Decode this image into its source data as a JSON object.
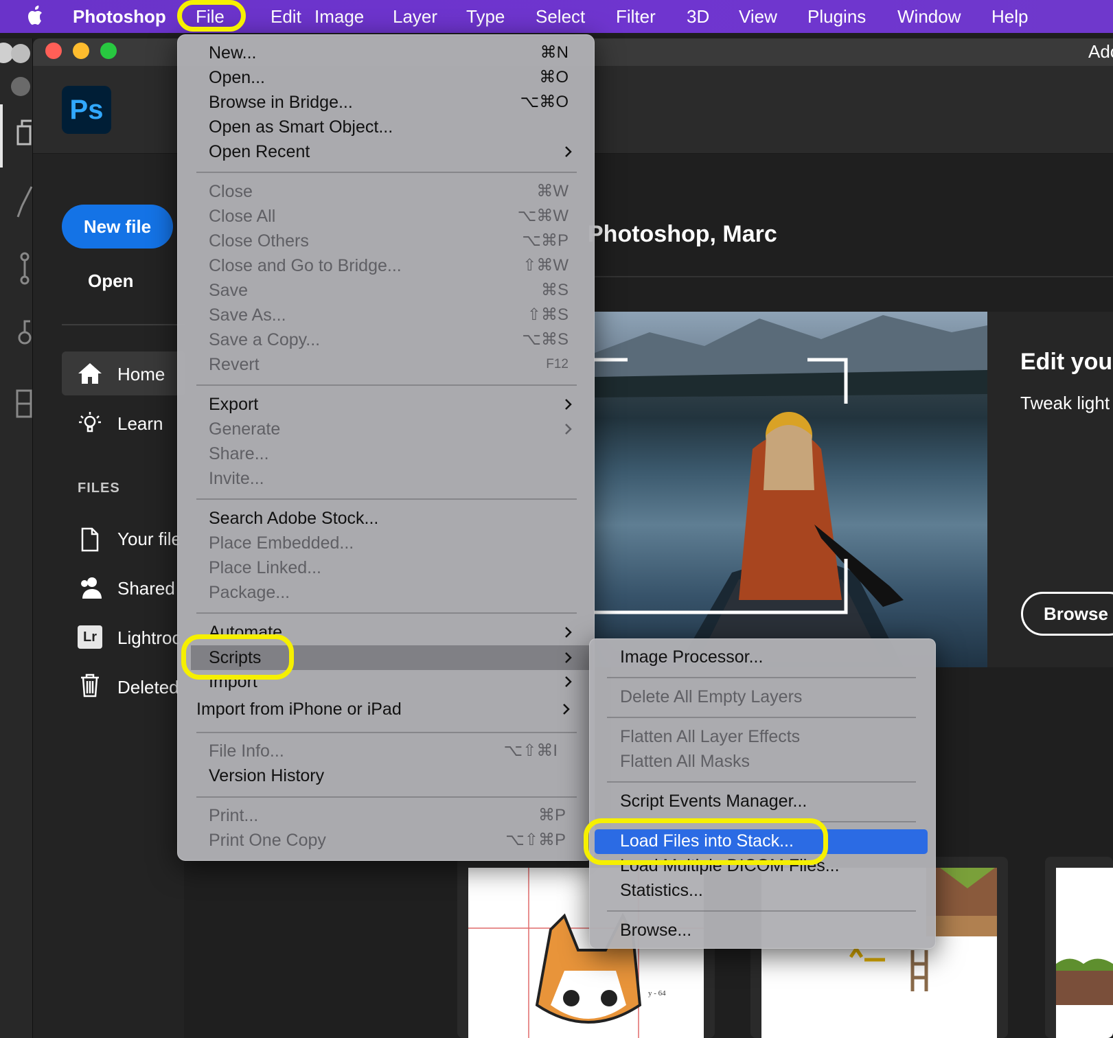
{
  "menubar": {
    "app_name": "Photoshop",
    "items": [
      "File",
      "Edit",
      "Image",
      "Layer",
      "Type",
      "Select",
      "Filter",
      "3D",
      "View",
      "Plugins",
      "Window",
      "Help"
    ]
  },
  "window": {
    "title_fragment": "Ado"
  },
  "sidebar": {
    "logo": "Ps",
    "new_file": "New file",
    "open": "Open",
    "nav": [
      "Home",
      "Learn"
    ],
    "files_header": "FILES",
    "files": [
      "Your files",
      "Shared",
      "Lightroom",
      "Deleted"
    ],
    "lr_badge": "Lr"
  },
  "main": {
    "greeting": "Photoshop, Marc",
    "hero_title": "Edit your",
    "hero_subtitle": "Tweak light",
    "browse_button": "Browse t",
    "thumb_label": "y - 64"
  },
  "file_menu": {
    "groups": [
      [
        {
          "label": "New...",
          "shortcut": "⌘N",
          "enabled": true
        },
        {
          "label": "Open...",
          "shortcut": "⌘O",
          "enabled": true
        },
        {
          "label": "Browse in Bridge...",
          "shortcut": "⌥⌘O",
          "enabled": true
        },
        {
          "label": "Open as Smart Object...",
          "shortcut": "",
          "enabled": true
        },
        {
          "label": "Open Recent",
          "shortcut": "",
          "enabled": true,
          "submenu": true
        }
      ],
      [
        {
          "label": "Close",
          "shortcut": "⌘W",
          "enabled": false
        },
        {
          "label": "Close All",
          "shortcut": "⌥⌘W",
          "enabled": false
        },
        {
          "label": "Close Others",
          "shortcut": "⌥⌘P",
          "enabled": false
        },
        {
          "label": "Close and Go to Bridge...",
          "shortcut": "⇧⌘W",
          "enabled": false
        },
        {
          "label": "Save",
          "shortcut": "⌘S",
          "enabled": false
        },
        {
          "label": "Save As...",
          "shortcut": "⇧⌘S",
          "enabled": false
        },
        {
          "label": "Save a Copy...",
          "shortcut": "⌥⌘S",
          "enabled": false
        },
        {
          "label": "Revert",
          "shortcut": "F12",
          "enabled": false
        }
      ],
      [
        {
          "label": "Export",
          "shortcut": "",
          "enabled": true,
          "submenu": true
        },
        {
          "label": "Generate",
          "shortcut": "",
          "enabled": false,
          "submenu": true
        },
        {
          "label": "Share...",
          "shortcut": "",
          "enabled": false
        },
        {
          "label": "Invite...",
          "shortcut": "",
          "enabled": false
        }
      ],
      [
        {
          "label": "Search Adobe Stock...",
          "shortcut": "",
          "enabled": true
        },
        {
          "label": "Place Embedded...",
          "shortcut": "",
          "enabled": false
        },
        {
          "label": "Place Linked...",
          "shortcut": "",
          "enabled": false
        },
        {
          "label": "Package...",
          "shortcut": "",
          "enabled": false
        }
      ],
      [
        {
          "label": "Automate",
          "shortcut": "",
          "enabled": true,
          "submenu": true
        },
        {
          "label": "Scripts",
          "shortcut": "",
          "enabled": true,
          "submenu": true,
          "highlighted": true
        },
        {
          "label": "Import",
          "shortcut": "",
          "enabled": true,
          "submenu": true
        },
        {
          "label": "Import from iPhone or iPad",
          "shortcut": "",
          "enabled": true,
          "submenu": true
        }
      ],
      [
        {
          "label": "File Info...",
          "shortcut": "⌥⇧⌘I",
          "enabled": false
        },
        {
          "label": "Version History",
          "shortcut": "",
          "enabled": true
        }
      ],
      [
        {
          "label": "Print...",
          "shortcut": "⌘P",
          "enabled": false
        },
        {
          "label": "Print One Copy",
          "shortcut": "⌥⇧⌘P",
          "enabled": false
        }
      ]
    ]
  },
  "scripts_menu": {
    "groups": [
      [
        {
          "label": "Image Processor...",
          "enabled": true
        }
      ],
      [
        {
          "label": "Delete All Empty Layers",
          "enabled": false
        }
      ],
      [
        {
          "label": "Flatten All Layer Effects",
          "enabled": false
        },
        {
          "label": "Flatten All Masks",
          "enabled": false
        }
      ],
      [
        {
          "label": "Script Events Manager...",
          "enabled": true
        }
      ],
      [
        {
          "label": "Load Files into Stack...",
          "enabled": true,
          "selected": true
        },
        {
          "label": "Load Multiple DICOM Files...",
          "enabled": true
        },
        {
          "label": "Statistics...",
          "enabled": true
        }
      ],
      [
        {
          "label": "Browse...",
          "enabled": true
        }
      ]
    ]
  },
  "colors": {
    "menubar": "#6f35cf",
    "accent": "#1473e6",
    "selection": "#2b6be4",
    "annotation": "#f6f000"
  }
}
